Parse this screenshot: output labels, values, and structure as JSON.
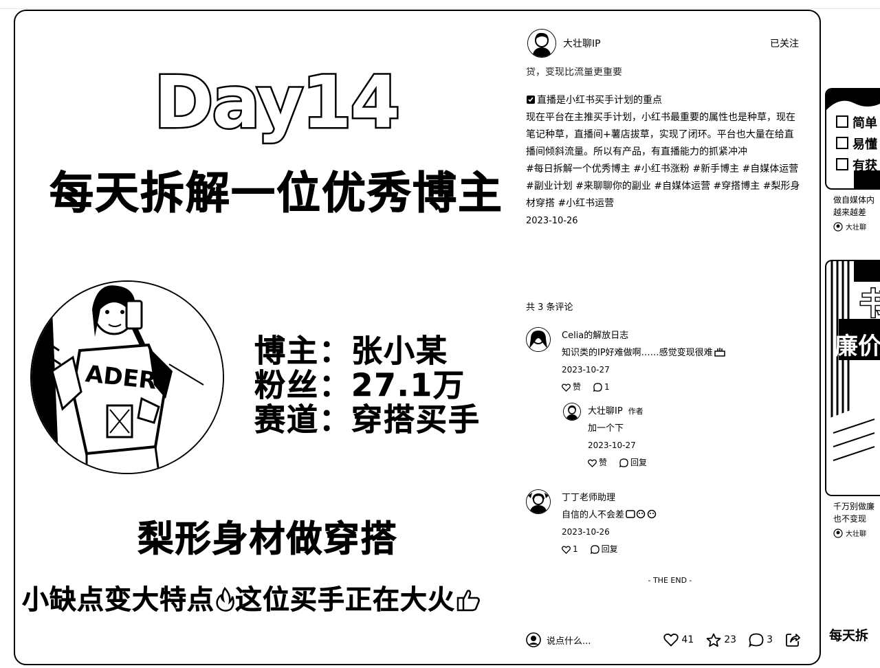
{
  "poster": {
    "day_title": "Day14",
    "sub_title": "每天拆解一位优秀博主",
    "stats": [
      {
        "label": "博主：",
        "value": "张小某"
      },
      {
        "label": "粉丝：",
        "value": "27.1万"
      },
      {
        "label": "赛道：",
        "value": "穿搭买手"
      }
    ],
    "headline1": "梨形身材做穿搭",
    "headline2_a": "小缺点变大特点",
    "headline2_b": "这位买手正在大火",
    "shirt_text": "ADER"
  },
  "panel": {
    "author_name": "大壮聊IP",
    "follow_label": "已关注",
    "cut_line": "贷，变现比流量更重要",
    "section_title": "直播是小红书买手计划的重点",
    "paragraph": "现在平台在主推买手计划，小红书最重要的属性也是种草，现在笔记种草，直播间+薯店拔草，实现了闭环。平台也大量在给直播间倾斜流量。所以有产品，有直播能力的抓紧冲冲",
    "tags": "#每日拆解一个优秀博主 #小红书涨粉 #新手博主 #自媒体运营 #副业计划 #来聊聊你的副业 #自媒体运营 #穿搭博主 #梨形身材穿搭 #小红书运营",
    "date": "2023-10-26",
    "comment_count": "共 3 条评论",
    "comments": [
      {
        "name": "Celia的解放日志",
        "text": "知识类的IP好难做啊……感觉变现很难",
        "date": "2023-10-27",
        "like": "赞",
        "reply": "1"
      },
      {
        "name": "大壮聊IP",
        "author_tag": "作者",
        "text": "加一个下",
        "date": "2023-10-27",
        "like": "赞",
        "reply": "回复"
      },
      {
        "name": "丁丁老师助理",
        "text": "自信的人不会差",
        "date": "2023-10-26",
        "like": "1",
        "reply": "回复"
      }
    ],
    "the_end": "- THE END -",
    "input_placeholder": "说点什么...",
    "likes": "41",
    "stars": "23",
    "comments_total": "3"
  },
  "feed": {
    "card1_lines": [
      "简单",
      "易懂",
      "有获"
    ],
    "card1_text1": "做自媒体内",
    "card1_text2": "越来越差",
    "card1_author": "大壮聊",
    "card2_big1": "书",
    "card2_big2": "廉价",
    "card2_text1": "千万别做廉",
    "card2_text2": "也不变现",
    "card2_author": "大壮聊",
    "bottom_text": "每天拆"
  },
  "colors": {
    "ink": "#000000",
    "paper": "#ffffff"
  }
}
